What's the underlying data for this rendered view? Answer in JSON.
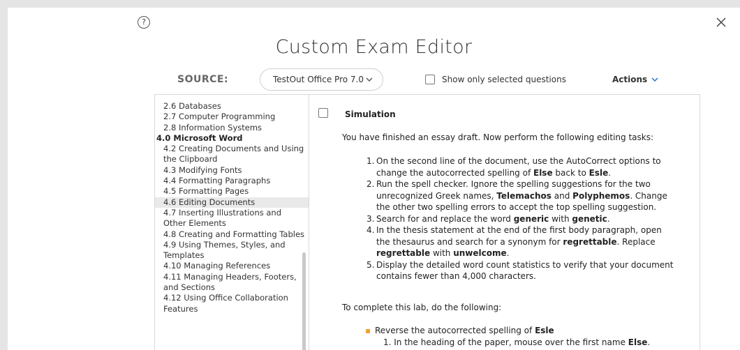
{
  "title": "Custom Exam Editor",
  "help_glyph": "?",
  "source": {
    "label": "SOURCE:",
    "selected": "TestOut Office Pro 7.0"
  },
  "show_only_label": "Show only selected questions",
  "actions_label": "Actions",
  "toc": [
    {
      "label": "2.6 Databases",
      "type": "item"
    },
    {
      "label": "2.7 Computer Programming",
      "type": "item"
    },
    {
      "label": "2.8 Information Systems",
      "type": "item"
    },
    {
      "label": "4.0 Microsoft Word",
      "type": "chapter"
    },
    {
      "label": "4.2 Creating Documents and Using the Clipboard",
      "type": "item"
    },
    {
      "label": "4.3 Modifying Fonts",
      "type": "item"
    },
    {
      "label": "4.4 Formatting Paragraphs",
      "type": "item"
    },
    {
      "label": "4.5 Formatting Pages",
      "type": "item"
    },
    {
      "label": "4.6 Editing Documents",
      "type": "item",
      "selected": true
    },
    {
      "label": "4.7 Inserting Illustrations and Other Elements",
      "type": "item"
    },
    {
      "label": "4.8 Creating and Formatting Tables",
      "type": "item"
    },
    {
      "label": "4.9 Using Themes, Styles, and Templates",
      "type": "item"
    },
    {
      "label": "4.10 Managing References",
      "type": "item"
    },
    {
      "label": "4.11 Managing Headers, Footers, and Sections",
      "type": "item"
    },
    {
      "label": "4.12 Using Office Collaboration Features",
      "type": "item"
    }
  ],
  "question": {
    "type": "Simulation",
    "intro": "You have finished an essay draft. Now perform the following editing tasks:",
    "tasks": [
      {
        "num": "1.",
        "parts": [
          {
            "t": "On the second line of the document, use the AutoCorrect options to change the autocorrected spelling of "
          },
          {
            "t": "Else",
            "b": true
          },
          {
            "t": " back to "
          },
          {
            "t": "Esle",
            "b": true
          },
          {
            "t": "."
          }
        ]
      },
      {
        "num": "2.",
        "parts": [
          {
            "t": "Run the spell checker. Ignore the spelling suggestions for the two unrecognized Greek names, "
          },
          {
            "t": "Telemachos",
            "b": true
          },
          {
            "t": " and "
          },
          {
            "t": "Polyphemos",
            "b": true
          },
          {
            "t": ". Change the other two spelling errors to accept the top spelling suggestion."
          }
        ]
      },
      {
        "num": "3.",
        "parts": [
          {
            "t": "Search for and replace the word "
          },
          {
            "t": "generic",
            "b": true
          },
          {
            "t": " with "
          },
          {
            "t": "genetic",
            "b": true
          },
          {
            "t": "."
          }
        ]
      },
      {
        "num": "4.",
        "parts": [
          {
            "t": "In the thesis statement at the end of the first body paragraph, open the thesaurus and search for a synonym for "
          },
          {
            "t": "regrettable",
            "b": true
          },
          {
            "t": ". Replace "
          },
          {
            "t": "regrettable",
            "b": true
          },
          {
            "t": " with "
          },
          {
            "t": "unwelcome",
            "b": true
          },
          {
            "t": "."
          }
        ]
      },
      {
        "num": "5.",
        "parts": [
          {
            "t": "Display the detailed word count statistics to verify that your document contains fewer than 4,000 characters."
          }
        ]
      }
    ],
    "complete_intro": "To complete this lab, do the following:",
    "bullet": [
      {
        "t": "Reverse the autocorrected spelling of "
      },
      {
        "t": "Esle",
        "b": true
      }
    ],
    "sub_item": [
      {
        "t": "1. In the heading of the paper, mouse over the first name "
      },
      {
        "t": "Else",
        "b": true
      },
      {
        "t": "."
      }
    ]
  },
  "colors": {
    "accent": "#1a73c9",
    "bullet": "#f0a030",
    "selected_row": "#e9e9e9"
  }
}
